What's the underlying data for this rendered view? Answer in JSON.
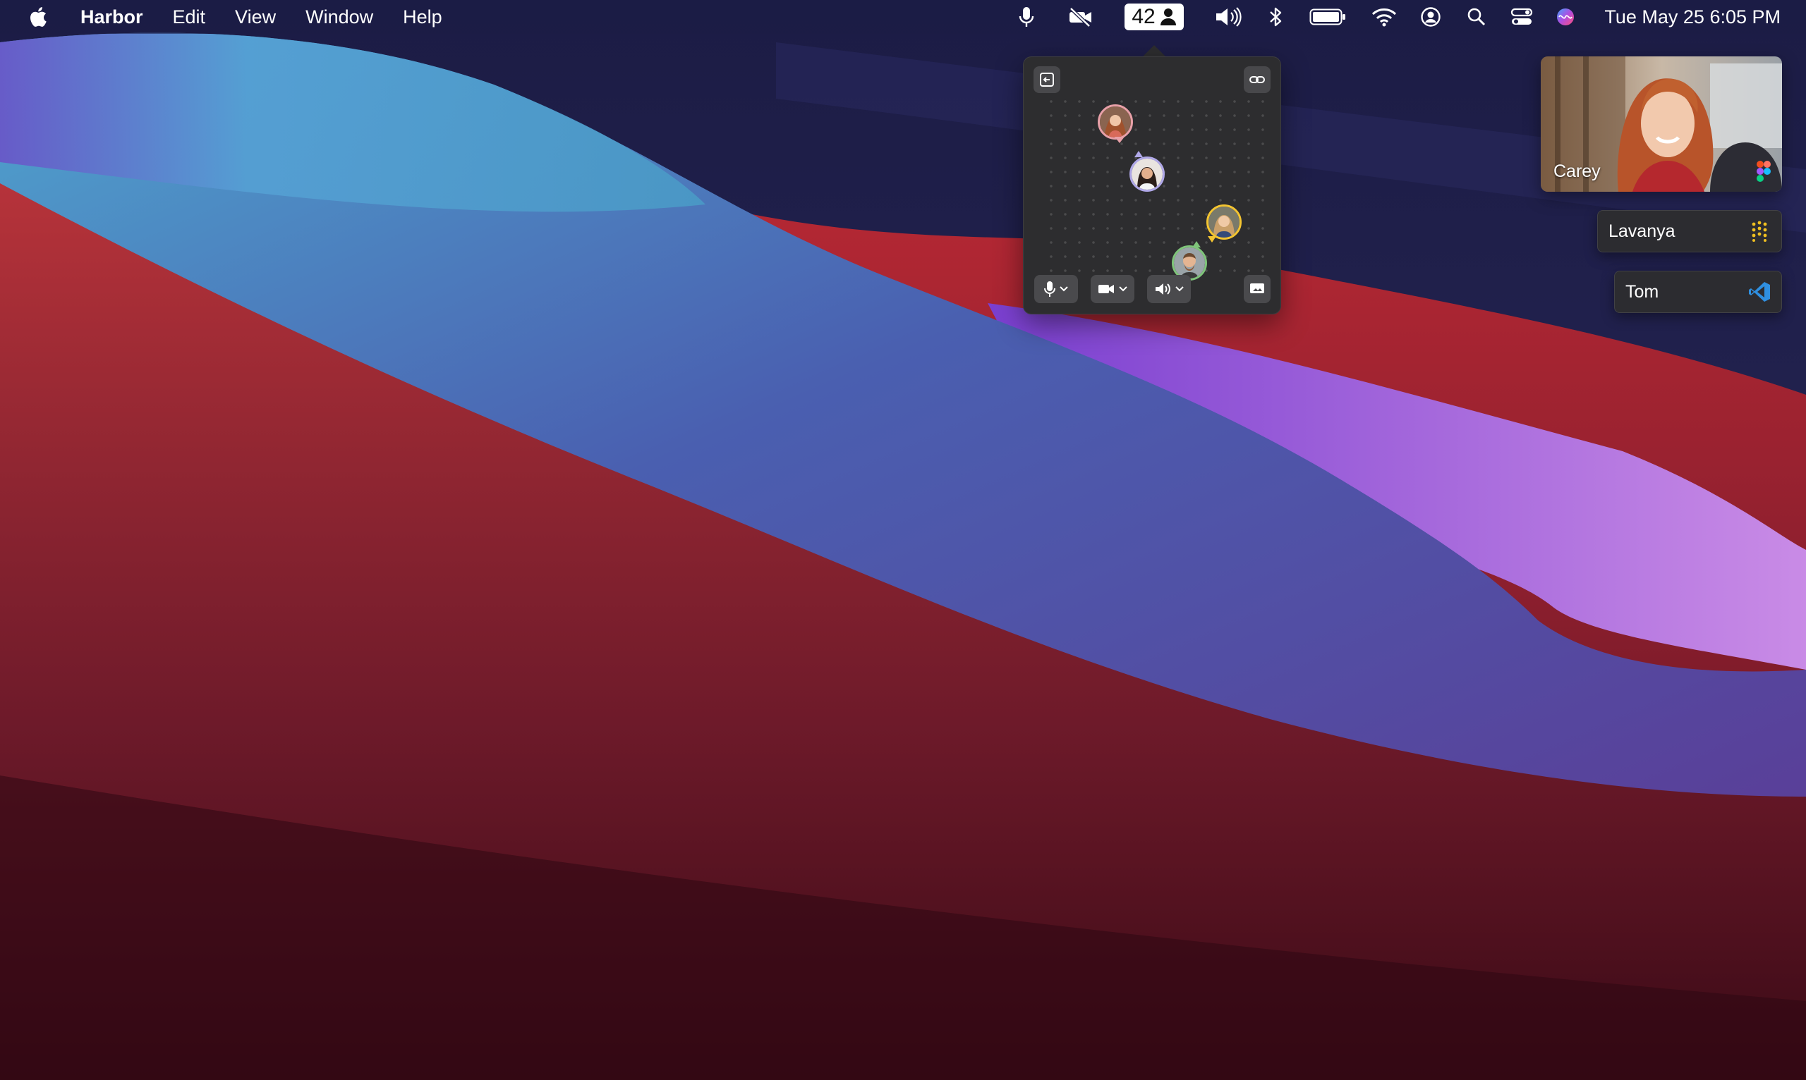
{
  "menubar": {
    "app_name": "Harbor",
    "menus": [
      "Edit",
      "View",
      "Window",
      "Help"
    ],
    "people_count": "42",
    "clock": "Tue May 25  6:05 PM",
    "status_icons": [
      "microphone-icon",
      "camera-off-icon",
      "volume-icon",
      "bluetooth-icon",
      "battery-icon",
      "wifi-icon",
      "user-account-icon",
      "spotlight-search-icon",
      "control-center-icon",
      "siri-icon"
    ]
  },
  "popover": {
    "top_left_button_icon": "leave-exit-icon",
    "top_right_button_icon": "link-icon",
    "controls": [
      "microphone-dropdown",
      "camera-dropdown",
      "speaker-dropdown",
      "screen-share"
    ],
    "avatar_ring_colors": [
      "#e8a0a8",
      "#b0a8e8",
      "#f3c431",
      "#7fc47a"
    ]
  },
  "participants": {
    "video": {
      "name": "Carey",
      "app_icon": "figma-icon"
    },
    "tiles": [
      {
        "name": "Lavanya",
        "app_icon": "dots-grid-icon"
      },
      {
        "name": "Tom",
        "app_icon": "vscode-icon"
      }
    ]
  },
  "colors": {
    "accent": "#ffffff",
    "popover_bg": "#2d2d2f",
    "menubar_bg": "#1c1e46"
  }
}
